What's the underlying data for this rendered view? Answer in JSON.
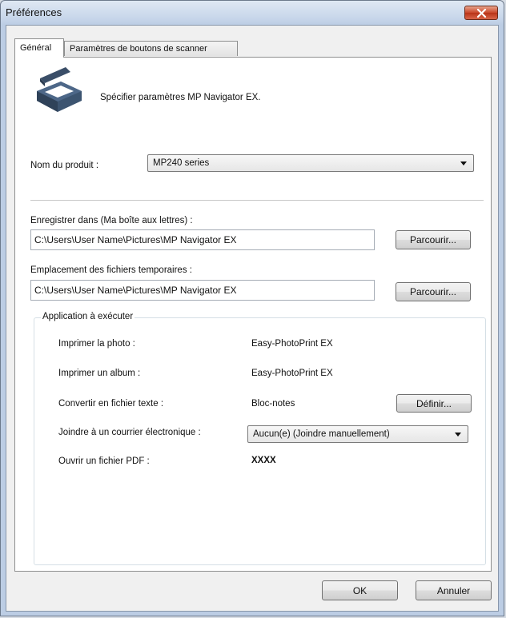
{
  "window": {
    "title": "Préférences"
  },
  "tabs": [
    {
      "label": "Général",
      "active": true
    },
    {
      "label": "Paramètres de boutons de scanner",
      "active": false
    }
  ],
  "header": {
    "icon": "scanner-icon",
    "description": "Spécifier paramètres MP Navigator EX."
  },
  "product": {
    "label": "Nom du produit :",
    "value": "MP240 series"
  },
  "save_to": {
    "label": "Enregistrer dans (Ma boîte aux lettres) :",
    "value": "C:\\Users\\User Name\\Pictures\\MP Navigator EX",
    "browse_label": "Parcourir..."
  },
  "temp_location": {
    "label": "Emplacement des fichiers temporaires :",
    "value": "C:\\Users\\User Name\\Pictures\\MP Navigator EX",
    "browse_label": "Parcourir..."
  },
  "apps": {
    "legend": "Application à exécuter",
    "rows": [
      {
        "label": "Imprimer la photo :",
        "value": "Easy-PhotoPrint EX"
      },
      {
        "label": "Imprimer un album :",
        "value": "Easy-PhotoPrint EX"
      },
      {
        "label": "Convertir en fichier texte :",
        "value": "Bloc-notes",
        "button_label": "Définir..."
      },
      {
        "label": "Joindre à un courrier électronique :",
        "value": "Aucun(e) (Joindre manuellement)"
      },
      {
        "label": "Ouvrir un fichier PDF :",
        "value": "XXXX"
      }
    ]
  },
  "footer": {
    "ok_label": "OK",
    "cancel_label": "Annuler"
  },
  "colors": {
    "title_gradient": "#c7d6ea",
    "close_button": "#c9462a",
    "panel_bg": "#ffffff",
    "dialog_bg": "#f0f0f0"
  }
}
